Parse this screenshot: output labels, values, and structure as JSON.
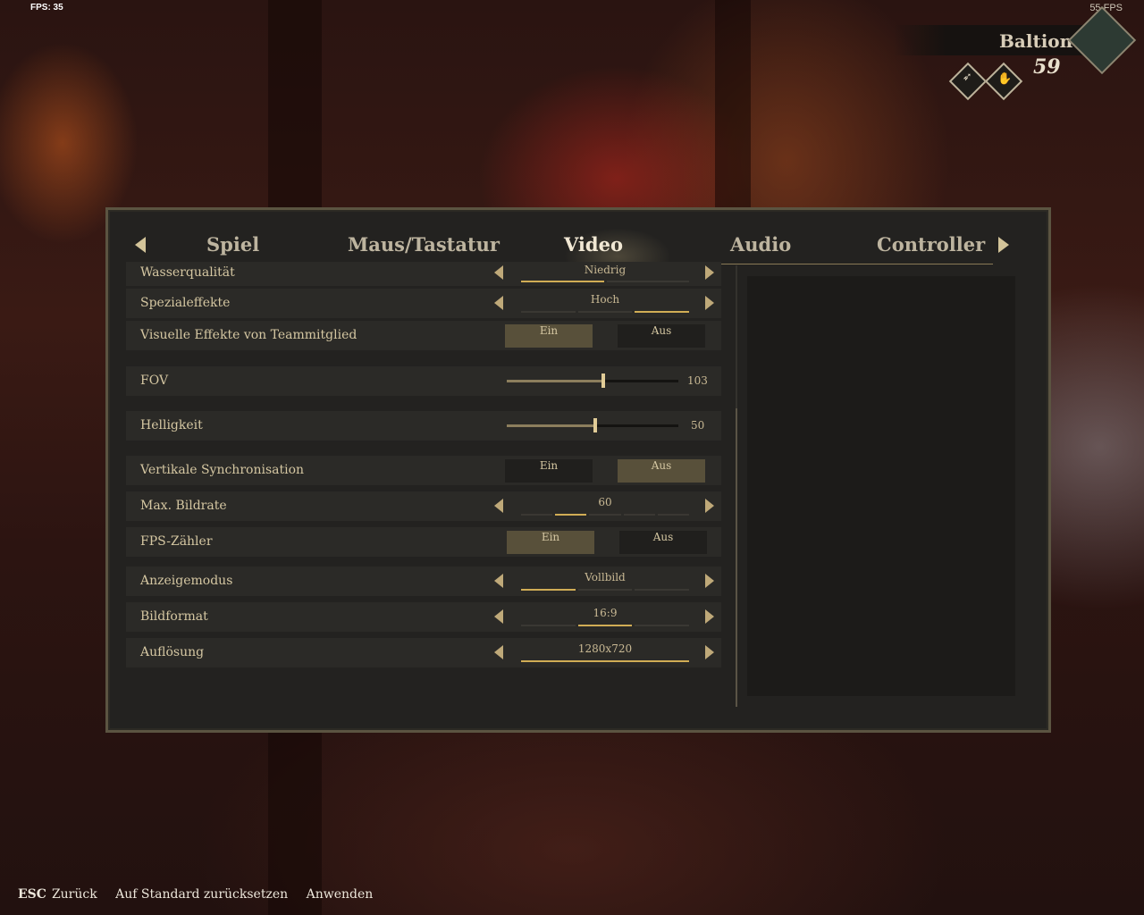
{
  "overlay": {
    "fps_left": "FPS: 35",
    "fps_right": "55 FPS"
  },
  "character": {
    "name": "Baltion",
    "level": "59",
    "skill_icons": [
      "eagle-icon",
      "hand-icon"
    ]
  },
  "tabs": {
    "items": [
      {
        "label": "Spiel",
        "active": false
      },
      {
        "label": "Maus/Tastatur",
        "active": false
      },
      {
        "label": "Video",
        "active": true
      },
      {
        "label": "Audio",
        "active": false
      },
      {
        "label": "Controller",
        "active": false
      }
    ]
  },
  "settings": {
    "water_quality": {
      "label": "Wasserqualität",
      "value": "Niedrig",
      "level_index": 0,
      "level_count": 2
    },
    "special_effects": {
      "label": "Spezialeffekte",
      "value": "Hoch",
      "level_index": 2,
      "level_count": 3
    },
    "team_vfx": {
      "label": "Visuelle Effekte von Teammitglied",
      "on": "Ein",
      "off": "Aus",
      "selected": "Ein"
    },
    "fov": {
      "label": "FOV",
      "value": "103",
      "fraction": 0.56
    },
    "brightness": {
      "label": "Helligkeit",
      "value": "50",
      "fraction": 0.51
    },
    "vsync": {
      "label": "Vertikale Synchronisation",
      "on": "Ein",
      "off": "Aus",
      "selected": "Aus"
    },
    "max_fps": {
      "label": "Max. Bildrate",
      "value": "60",
      "level_index": 1,
      "level_count": 5
    },
    "fps_counter": {
      "label": "FPS-Zähler",
      "on": "Ein",
      "off": "Aus",
      "selected": "Ein"
    },
    "display_mode": {
      "label": "Anzeigemodus",
      "value": "Vollbild",
      "level_index": 0,
      "level_count": 3
    },
    "aspect_ratio": {
      "label": "Bildformat",
      "value": "16:9",
      "level_index": 1,
      "level_count": 3
    },
    "resolution": {
      "label": "Auflösung",
      "value": "1280x720",
      "level_index": 0,
      "level_count": 1
    }
  },
  "footer": {
    "esc_key": "ESC",
    "back_label": "Zurück",
    "reset_label": "Auf Standard zurücksetzen",
    "apply_label": "Anwenden"
  },
  "colors": {
    "accent": "#d1ad55",
    "panel": "#232220",
    "text": "#d5c7a2"
  }
}
